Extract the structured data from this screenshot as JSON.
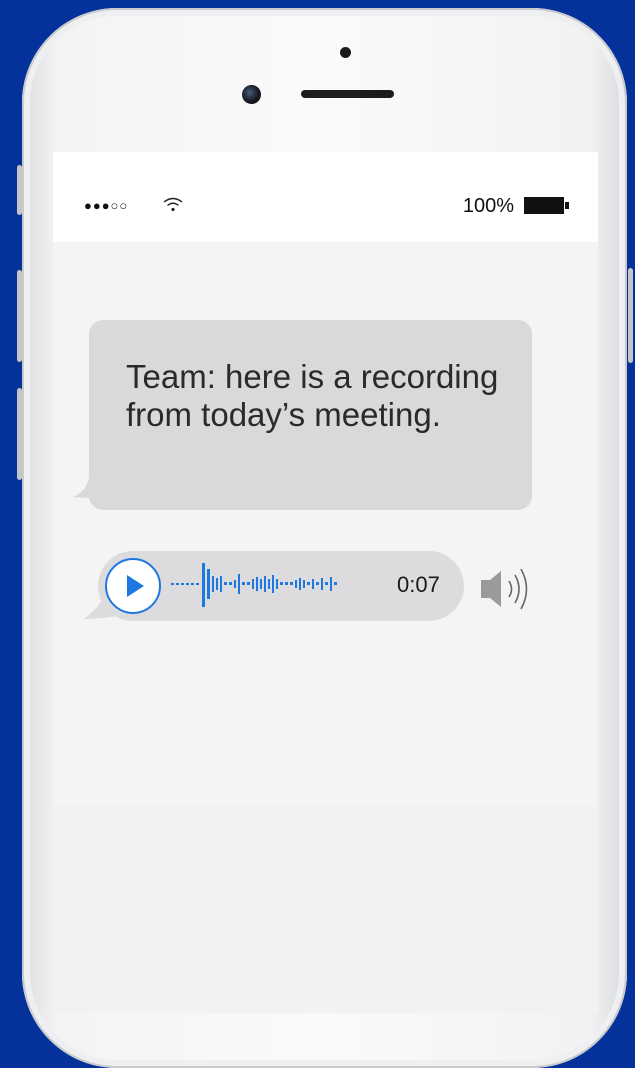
{
  "status_bar": {
    "signal": "●●●○○",
    "battery_percent": "100%"
  },
  "message": {
    "text": "Team: here is a recording from today’s meeting."
  },
  "audio": {
    "duration": "0:07",
    "accent_color": "#1e78e0"
  },
  "icons": {
    "wifi": "wifi-icon",
    "battery": "battery-icon",
    "play": "play-icon",
    "speaker": "speaker-icon"
  }
}
